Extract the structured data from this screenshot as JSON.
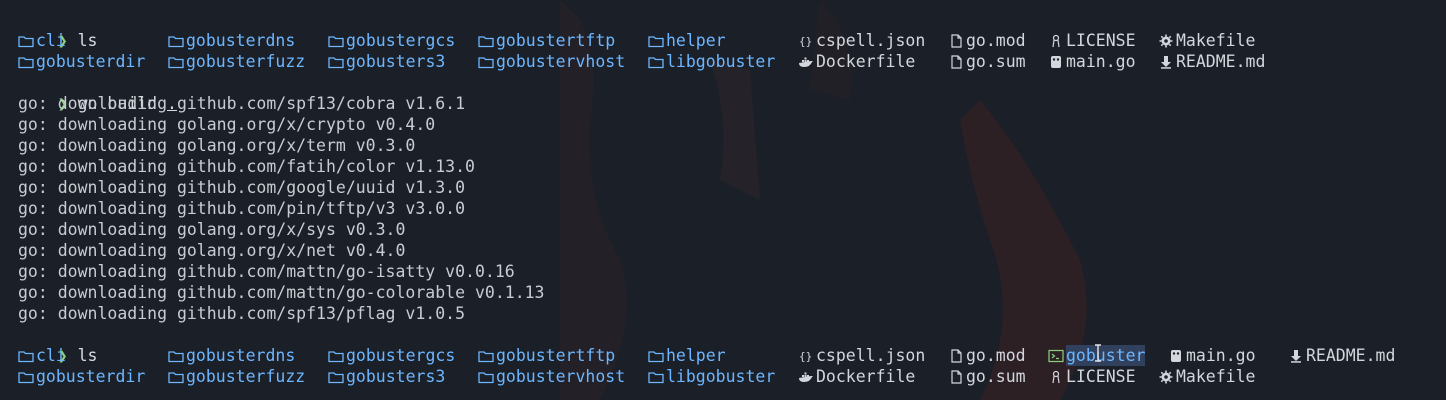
{
  "terminal": {
    "prompt_symbol": "❯",
    "commands": {
      "ls1": "ls",
      "build": "go build ",
      "build_dot": ".",
      "ls2": "ls"
    },
    "ls1": {
      "row1": [
        {
          "name": "cli",
          "type": "dir",
          "icon": "folder-icon"
        },
        {
          "name": "gobusterdns",
          "type": "dir",
          "icon": "folder-icon"
        },
        {
          "name": "gobustergcs",
          "type": "dir",
          "icon": "folder-icon"
        },
        {
          "name": "gobustertftp",
          "type": "dir",
          "icon": "folder-icon"
        },
        {
          "name": "helper",
          "type": "dir",
          "icon": "folder-icon"
        },
        {
          "name": "cspell.json",
          "type": "file",
          "icon": "json-braces-icon"
        },
        {
          "name": "go.mod",
          "type": "file",
          "icon": "file-icon"
        },
        {
          "name": "LICENSE",
          "type": "file",
          "icon": "license-icon"
        },
        {
          "name": "Makefile",
          "type": "file",
          "icon": "gear-icon"
        }
      ],
      "row2": [
        {
          "name": "gobusterdir",
          "type": "dir",
          "icon": "folder-icon"
        },
        {
          "name": "gobusterfuzz",
          "type": "dir",
          "icon": "folder-icon"
        },
        {
          "name": "gobusters3",
          "type": "dir",
          "icon": "folder-icon"
        },
        {
          "name": "gobustervhost",
          "type": "dir",
          "icon": "folder-icon"
        },
        {
          "name": "libgobuster",
          "type": "dir",
          "icon": "folder-icon"
        },
        {
          "name": "Dockerfile",
          "type": "file",
          "icon": "docker-icon"
        },
        {
          "name": "go.sum",
          "type": "file",
          "icon": "file-icon"
        },
        {
          "name": "main.go",
          "type": "file",
          "icon": "go-gopher-icon"
        },
        {
          "name": "README.md",
          "type": "file",
          "icon": "download-arrow-icon"
        }
      ]
    },
    "downloads": [
      "go: downloading github.com/spf13/cobra v1.6.1",
      "go: downloading golang.org/x/crypto v0.4.0",
      "go: downloading golang.org/x/term v0.3.0",
      "go: downloading github.com/fatih/color v1.13.0",
      "go: downloading github.com/google/uuid v1.3.0",
      "go: downloading github.com/pin/tftp/v3 v3.0.0",
      "go: downloading golang.org/x/sys v0.3.0",
      "go: downloading golang.org/x/net v0.4.0",
      "go: downloading github.com/mattn/go-isatty v0.0.16",
      "go: downloading github.com/mattn/go-colorable v0.1.13",
      "go: downloading github.com/spf13/pflag v1.0.5"
    ],
    "ls2": {
      "row1": [
        {
          "name": "cli",
          "type": "dir",
          "icon": "folder-icon"
        },
        {
          "name": "gobusterdns",
          "type": "dir",
          "icon": "folder-icon"
        },
        {
          "name": "gobustergcs",
          "type": "dir",
          "icon": "folder-icon"
        },
        {
          "name": "gobustertftp",
          "type": "dir",
          "icon": "folder-icon"
        },
        {
          "name": "helper",
          "type": "dir",
          "icon": "folder-icon"
        },
        {
          "name": "cspell.json",
          "type": "file",
          "icon": "json-braces-icon"
        },
        {
          "name": "go.mod",
          "type": "file",
          "icon": "file-icon"
        },
        {
          "name": "gobuster",
          "type": "exec",
          "icon": "terminal-icon"
        },
        {
          "name": "main.go",
          "type": "file",
          "icon": "go-gopher-icon"
        },
        {
          "name": "README.md",
          "type": "file",
          "icon": "download-arrow-icon"
        }
      ],
      "row2": [
        {
          "name": "gobusterdir",
          "type": "dir",
          "icon": "folder-icon"
        },
        {
          "name": "gobusterfuzz",
          "type": "dir",
          "icon": "folder-icon"
        },
        {
          "name": "gobusters3",
          "type": "dir",
          "icon": "folder-icon"
        },
        {
          "name": "gobustervhost",
          "type": "dir",
          "icon": "folder-icon"
        },
        {
          "name": "libgobuster",
          "type": "dir",
          "icon": "folder-icon"
        },
        {
          "name": "Dockerfile",
          "type": "file",
          "icon": "docker-icon"
        },
        {
          "name": "go.sum",
          "type": "file",
          "icon": "file-icon"
        },
        {
          "name": "LICENSE",
          "type": "file",
          "icon": "license-icon"
        },
        {
          "name": "Makefile",
          "type": "file",
          "icon": "gear-icon"
        }
      ]
    },
    "colors": {
      "background": "#1b1f27",
      "prompt": "#8ccf7e",
      "directory": "#6cb6ff",
      "text": "#c8ccd2",
      "selection": "#31405c"
    }
  }
}
